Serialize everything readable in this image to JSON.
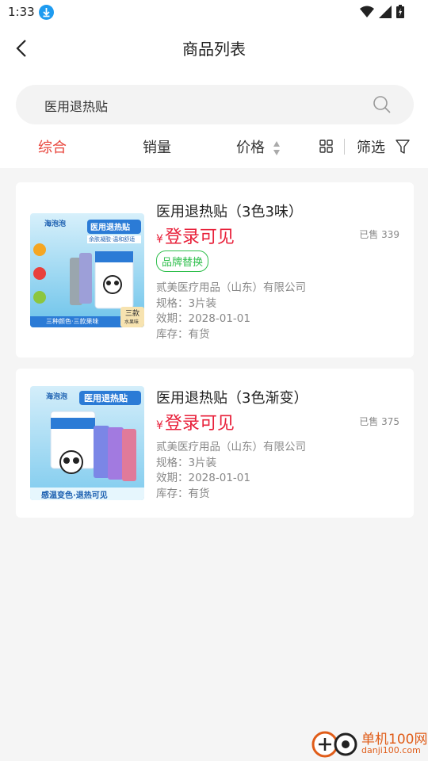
{
  "status": {
    "time": "1:33"
  },
  "header": {
    "title": "商品列表"
  },
  "search": {
    "value": "医用退热贴"
  },
  "sort": {
    "comprehensive": "综合",
    "sales": "销量",
    "price": "价格",
    "filter": "筛选"
  },
  "products": [
    {
      "name": "医用退热贴（3色3味）",
      "price_currency": "¥",
      "price": "登录可见",
      "sold": "已售 339",
      "tag": "品牌替换",
      "company": "贰美医疗用品（山东）有限公司",
      "spec": "规格：3片装",
      "expiry": "效期：2028-01-01",
      "stock": "库存：有货",
      "img_brand": "海泡泡",
      "img_title": "医用退热贴",
      "img_sub": "余肤凝胶·温和舒适",
      "img_footer": "三种颜色·三款果味",
      "img_corner": "三款",
      "img_corner2": "水果味"
    },
    {
      "name": "医用退热贴（3色渐变）",
      "price_currency": "¥",
      "price": "登录可见",
      "sold": "已售 375",
      "company": "贰美医疗用品（山东）有限公司",
      "spec": "规格：3片装",
      "expiry": "效期：2028-01-01",
      "stock": "库存：有货",
      "img_brand": "海泡泡",
      "img_title": "医用退热贴",
      "img_footer": "感温变色·退热可见"
    }
  ],
  "watermark": {
    "line1": "单机100网",
    "line2": "danji100.com"
  },
  "colors": {
    "accent": "#e8453c",
    "price": "#e8203a",
    "tag": "#2fbf4c"
  }
}
